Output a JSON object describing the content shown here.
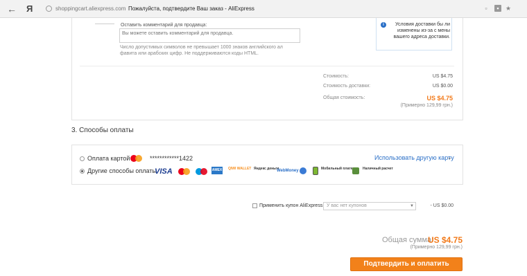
{
  "browser": {
    "back_glyph": "←",
    "yandex_glyph": "Я",
    "domain": "shoppingcart.aliexpress.com",
    "title": "Пожалуйста, подтвердите Ваш заказ - AliExpress"
  },
  "order": {
    "comment_label": "Оставить комментарий для продавца:",
    "comment_placeholder": "Вы можете оставить комментарий для продавца.",
    "comment_hint": "Число допустимых символов не превышает 1000 знаков английского ал фавита или арабских цифр. Не поддерживаются коды HTML.",
    "delivery_note": "Условия доставки бы ли изменены из-за с мены вашего адреса доставки.",
    "cost_label": "Стоимость:",
    "cost_value": "US $4.75",
    "shipping_label": "Стоимость доставки:",
    "shipping_value": "US $0.00",
    "total_label": "Общая стоимость:",
    "total_value": "US $4.75",
    "total_approx": "(Примерно 129,99 грн.)"
  },
  "payment": {
    "section_title": "3. Способы оплаты",
    "card_option_label": "Оплата картой",
    "card_number": "************1422",
    "use_other_card": "Использовать другую карту",
    "other_option_label": "Другие способы оплаты",
    "logos": {
      "visa": "VISA",
      "amex": "AMEX",
      "qiwi": "QIWI WALLET",
      "yandex": "Яндекс деньги",
      "webmoney": "WebMoney",
      "mobile": "Мобильный платеж",
      "cash": "Наличный расчет"
    }
  },
  "coupon": {
    "label": "Применить купон AliExpress:",
    "select_value": "У вас нет купонов",
    "value": "- US $0.00"
  },
  "summary": {
    "label": "Общая сумма:",
    "value": "US $4.75",
    "approx": "(Примерно 129,99 грн.)",
    "confirm_button": "Подтвердить и оплатить"
  },
  "colors": {
    "accent": "#f27a1a",
    "link": "#2a6fc7"
  }
}
